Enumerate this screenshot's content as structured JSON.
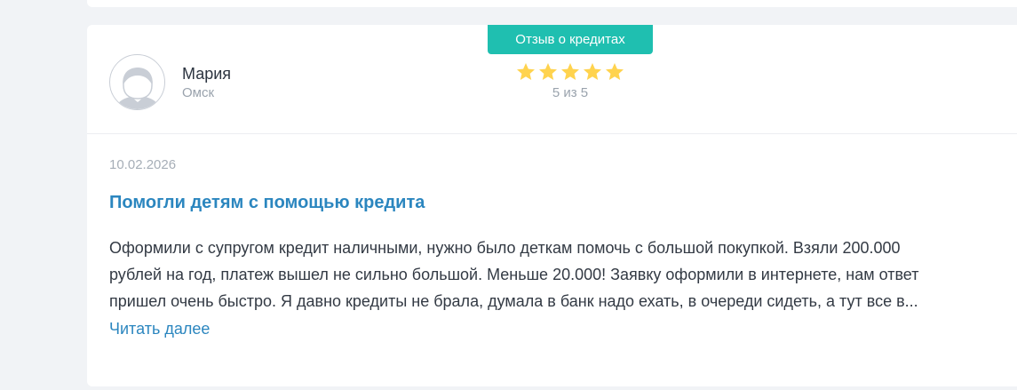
{
  "review": {
    "category_badge": "Отзыв о кредитах",
    "author": {
      "name": "Мария",
      "city": "Омск",
      "avatar_icon": "user-avatar-icon"
    },
    "rating": {
      "value": 5,
      "max": 5,
      "text": "5 из 5",
      "star_color": "#ffd34e"
    },
    "date": "10.02.2026",
    "title": "Помогли детям с помощью кредита",
    "lines": [
      "Оформили с супругом кредит наличными, нужно было деткам помочь с большой покупкой. Взяли 200.000",
      "рублей на год, платеж вышел не сильно большой. Меньше 20.000! Заявку оформили в интернете, нам ответ",
      "пришел очень быстро. Я давно кредиты не брала, думала в банк надо ехать, в очереди сидеть, а тут все в..."
    ],
    "read_more": "Читать далее"
  },
  "colors": {
    "accent_teal": "#1fbfb0",
    "link_blue": "#2b86bf"
  }
}
